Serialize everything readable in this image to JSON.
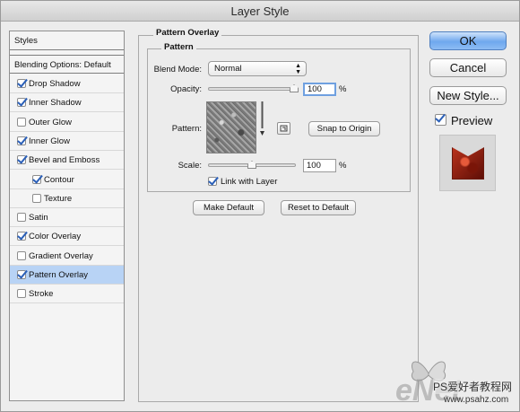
{
  "window": {
    "title": "Layer Style"
  },
  "sidebar": {
    "header": "Styles",
    "blending": "Blending Options: Default",
    "items": [
      {
        "label": "Drop Shadow",
        "checked": true,
        "indent": false
      },
      {
        "label": "Inner Shadow",
        "checked": true,
        "indent": false
      },
      {
        "label": "Outer Glow",
        "checked": false,
        "indent": false
      },
      {
        "label": "Inner Glow",
        "checked": true,
        "indent": false
      },
      {
        "label": "Bevel and Emboss",
        "checked": true,
        "indent": false
      },
      {
        "label": "Contour",
        "checked": true,
        "indent": true
      },
      {
        "label": "Texture",
        "checked": false,
        "indent": true
      },
      {
        "label": "Satin",
        "checked": false,
        "indent": false
      },
      {
        "label": "Color Overlay",
        "checked": true,
        "indent": false
      },
      {
        "label": "Gradient Overlay",
        "checked": false,
        "indent": false
      },
      {
        "label": "Pattern Overlay",
        "checked": true,
        "indent": false,
        "selected": true
      },
      {
        "label": "Stroke",
        "checked": false,
        "indent": false
      }
    ]
  },
  "panel": {
    "section_title": "Pattern Overlay",
    "group_title": "Pattern",
    "blend_mode_label": "Blend Mode:",
    "blend_mode_value": "Normal",
    "opacity_label": "Opacity:",
    "opacity_value": "100",
    "opacity_unit": "%",
    "pattern_label": "Pattern:",
    "snap_button": "Snap to Origin",
    "scale_label": "Scale:",
    "scale_value": "100",
    "scale_unit": "%",
    "link_label": "Link with Layer",
    "link_checked": true,
    "make_default": "Make Default",
    "reset_default": "Reset to Default"
  },
  "actions": {
    "ok": "OK",
    "cancel": "Cancel",
    "new_style": "New Style...",
    "preview_label": "Preview",
    "preview_checked": true
  },
  "watermark": {
    "brand": "eNet",
    "line1": "PS爱好者教程网",
    "line2": "www.psahz.com"
  },
  "colors": {
    "selection": "#b8d3f5",
    "default_button": "#6fa8ee",
    "checkmark": "#2a5fb8"
  }
}
